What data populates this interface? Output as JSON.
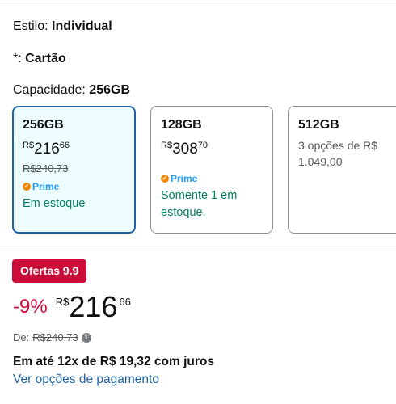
{
  "style": {
    "label": "Estilo:",
    "value": "Individual"
  },
  "card_field": {
    "label": "*:",
    "value": "Cartão"
  },
  "capacity": {
    "label": "Capacidade:",
    "value": "256GB"
  },
  "options": [
    {
      "cap": "256GB",
      "currency": "R$",
      "whole": "216",
      "cents": "66",
      "old": "R$240,73",
      "prime": "Prime",
      "stock": "Em estoque",
      "selected": true
    },
    {
      "cap": "128GB",
      "currency": "R$",
      "whole": "308",
      "cents": "70",
      "prime": "Prime",
      "stock": "Somente 1 em estoque.",
      "selected": false
    },
    {
      "cap": "512GB",
      "opts": "3 opções de R$ 1.049,00",
      "selected": false
    }
  ],
  "deal_badge": "Ofertas 9.9",
  "price": {
    "discount": "-9%",
    "currency": "R$",
    "whole": "216",
    "cents": "66"
  },
  "list_price": {
    "label": "De:",
    "value": "R$240,73"
  },
  "installments": "Em até 12x de R$ 19,32 com juros",
  "payment_link": "Ver opções de pagamento",
  "colors": {
    "deal": "#cc0c39",
    "link": "#2162a1",
    "stock": "#067d62",
    "selected_bg": "#edfdff"
  }
}
